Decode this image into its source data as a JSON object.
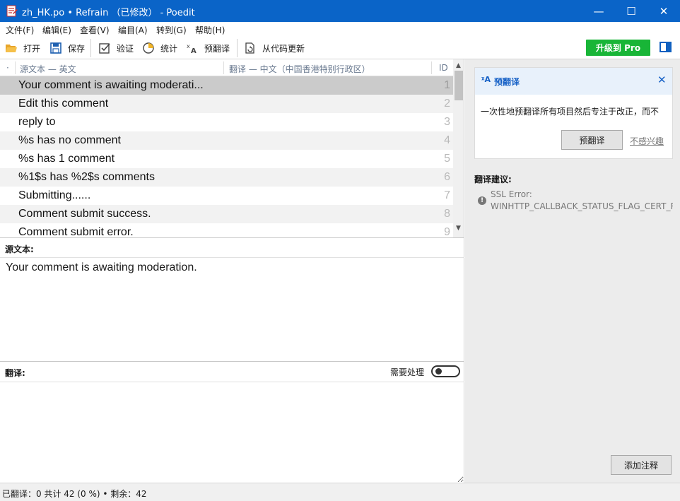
{
  "window": {
    "title": "zh_HK.po • Refrain （已修改） - Poedit",
    "min_glyph": "—",
    "max_glyph": "☐",
    "close_glyph": "✕"
  },
  "menu": [
    "文件(F)",
    "编辑(E)",
    "查看(V)",
    "编目(A)",
    "转到(G)",
    "帮助(H)"
  ],
  "toolbar": {
    "open": "打开",
    "save": "保存",
    "validate": "验证",
    "stats": "统计",
    "pretranslate": "预翻译",
    "update_from_code": "从代码更新",
    "upgrade_pro": "升级到 Pro"
  },
  "list": {
    "header_dot": "·",
    "header_source": "源文本 — 英文",
    "header_translation": "翻译 — 中文（中国香港特别行政区）",
    "header_id": "ID",
    "rows": [
      {
        "source": "Your comment is awaiting moderati...",
        "id": "1"
      },
      {
        "source": "Edit this comment",
        "id": "2"
      },
      {
        "source": "reply to",
        "id": "3"
      },
      {
        "source": "%s has no comment",
        "id": "4"
      },
      {
        "source": "%s has 1 comment",
        "id": "5"
      },
      {
        "source": "%1$s has %2$s comments",
        "id": "6"
      },
      {
        "source": "Submitting......",
        "id": "7"
      },
      {
        "source": "Comment submit success.",
        "id": "8"
      },
      {
        "source": "Comment submit error.",
        "id": "9"
      }
    ]
  },
  "source_pane": {
    "label": "源文本:",
    "text": "Your comment is awaiting moderation."
  },
  "translation_pane": {
    "label": "翻译:",
    "needs_work": "需要处理"
  },
  "sidebar": {
    "pretranslate_card": {
      "icon": "ᵡA",
      "title": "预翻译",
      "close": "✕",
      "description": "一次性地预翻译所有项目然后专注于改正，而不",
      "button": "预翻译",
      "dismiss": "不感兴趣"
    },
    "suggestions_label": "翻译建议:",
    "suggestion": {
      "icon": "!",
      "title": "SSL Error:",
      "detail": "WINHTTP_CALLBACK_STATUS_FLAG_CERT_REV"
    },
    "add_comment": "添加注释"
  },
  "status": "已翻译：0 共计 42 (0 %)  •  剩余：42",
  "colors": {
    "titlebar": "#0a64c8",
    "pro": "#18b537",
    "accent": "#1560c6"
  }
}
